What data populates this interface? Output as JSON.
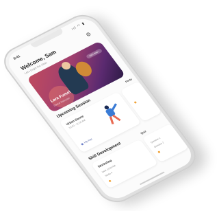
{
  "status": {
    "time": "9:41",
    "icons": "ııl ◠ ▮"
  },
  "header": {
    "greeting": "Welcome, Sam",
    "subtitle": "Let's begin the class"
  },
  "hero": {
    "name": "Lara Fumel",
    "meta": "Dance Instructor",
    "cta": "Join now ›"
  },
  "upcoming": {
    "title": "Upcoming Session",
    "side_title": "Perfo",
    "card": {
      "title": "Urban Dance",
      "sub": "10:00 - 11:00 AM",
      "tag": "Hip Hop"
    }
  },
  "skill": {
    "title": "Skill Development",
    "side_title": "Quiz",
    "card": {
      "title": "Workshop",
      "rows": [
        "Wed, 10:00 AM",
        "Studio 4"
      ]
    },
    "quiz_rows": [
      "Question 1",
      "Question 2"
    ]
  },
  "colors": {
    "accent": "#3a7bd5",
    "hero_start": "#c04a5e",
    "hero_end": "#2c1a44",
    "highlight": "#f0a236"
  }
}
